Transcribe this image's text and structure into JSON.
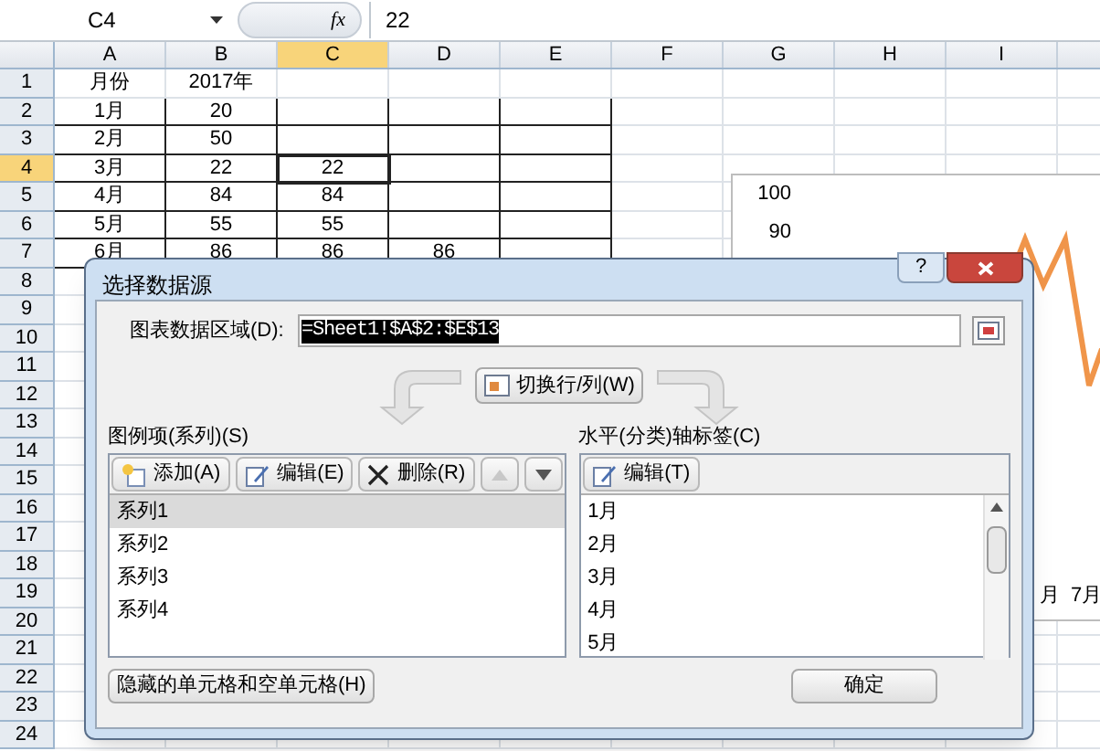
{
  "name_box": "C4",
  "function_label": "fx",
  "formula": "22",
  "columns": [
    {
      "label": "A",
      "selected": false
    },
    {
      "label": "B",
      "selected": false
    },
    {
      "label": "C",
      "selected": true
    },
    {
      "label": "D",
      "selected": false
    },
    {
      "label": "E",
      "selected": false
    },
    {
      "label": "F",
      "selected": false
    },
    {
      "label": "G",
      "selected": false
    },
    {
      "label": "H",
      "selected": false
    },
    {
      "label": "I",
      "selected": false
    }
  ],
  "rows": [
    {
      "label": "1",
      "selected": false,
      "cells": [
        "月份",
        "2017年"
      ]
    },
    {
      "label": "2",
      "selected": false,
      "cells": [
        "1月",
        "20"
      ]
    },
    {
      "label": "3",
      "selected": false,
      "cells": [
        "2月",
        "50"
      ]
    },
    {
      "label": "4",
      "selected": true,
      "cells": [
        "3月",
        "22",
        "22"
      ]
    },
    {
      "label": "5",
      "selected": false,
      "cells": [
        "4月",
        "84",
        "84"
      ]
    },
    {
      "label": "6",
      "selected": false,
      "cells": [
        "5月",
        "55",
        "55"
      ]
    },
    {
      "label": "7",
      "selected": false,
      "cells": [
        "6月",
        "86",
        "86",
        "86"
      ]
    },
    {
      "label": "8",
      "selected": false
    },
    {
      "label": "9",
      "selected": false
    },
    {
      "label": "10",
      "selected": false
    },
    {
      "label": "11",
      "selected": false
    },
    {
      "label": "12",
      "selected": false
    },
    {
      "label": "13",
      "selected": false
    },
    {
      "label": "14",
      "selected": false
    },
    {
      "label": "15",
      "selected": false
    },
    {
      "label": "16",
      "selected": false
    },
    {
      "label": "17",
      "selected": false
    },
    {
      "label": "18",
      "selected": false
    },
    {
      "label": "19",
      "selected": false
    },
    {
      "label": "20",
      "selected": false
    },
    {
      "label": "21",
      "selected": false
    },
    {
      "label": "22",
      "selected": false
    },
    {
      "label": "23",
      "selected": false
    },
    {
      "label": "24",
      "selected": false
    }
  ],
  "chart": {
    "y_labels": [
      "100",
      "90"
    ],
    "x_labels": [
      "月",
      "7月"
    ]
  },
  "dialog": {
    "title": "选择数据源",
    "help_button": "?",
    "range_label": "图表数据区域(D):",
    "range_value": "=Sheet1!$A$2:$E$13",
    "switch_button": "切换行/列(W)",
    "series_panel": {
      "label": "图例项(系列)(S)",
      "buttons": [
        {
          "kind": "add",
          "label": "添加(A)"
        },
        {
          "kind": "edit",
          "label": "编辑(E)"
        },
        {
          "kind": "remove",
          "label": "删除(R)"
        },
        {
          "kind": "up",
          "disabled": true
        },
        {
          "kind": "down",
          "disabled": false
        }
      ],
      "items": [
        {
          "label": "系列1",
          "selected": true
        },
        {
          "label": "系列2",
          "selected": false
        },
        {
          "label": "系列3",
          "selected": false
        },
        {
          "label": "系列4",
          "selected": false
        }
      ]
    },
    "axis_panel": {
      "label": "水平(分类)轴标签(C)",
      "buttons": [
        {
          "kind": "edit",
          "label": "编辑(T)"
        }
      ],
      "items": [
        {
          "label": "1月",
          "selected": false
        },
        {
          "label": "2月",
          "selected": false
        },
        {
          "label": "3月",
          "selected": false
        },
        {
          "label": "4月",
          "selected": false
        },
        {
          "label": "5月",
          "selected": false
        }
      ]
    },
    "hidden_cells_button": "隐藏的单元格和空单元格(H)",
    "ok_button": "确定"
  }
}
